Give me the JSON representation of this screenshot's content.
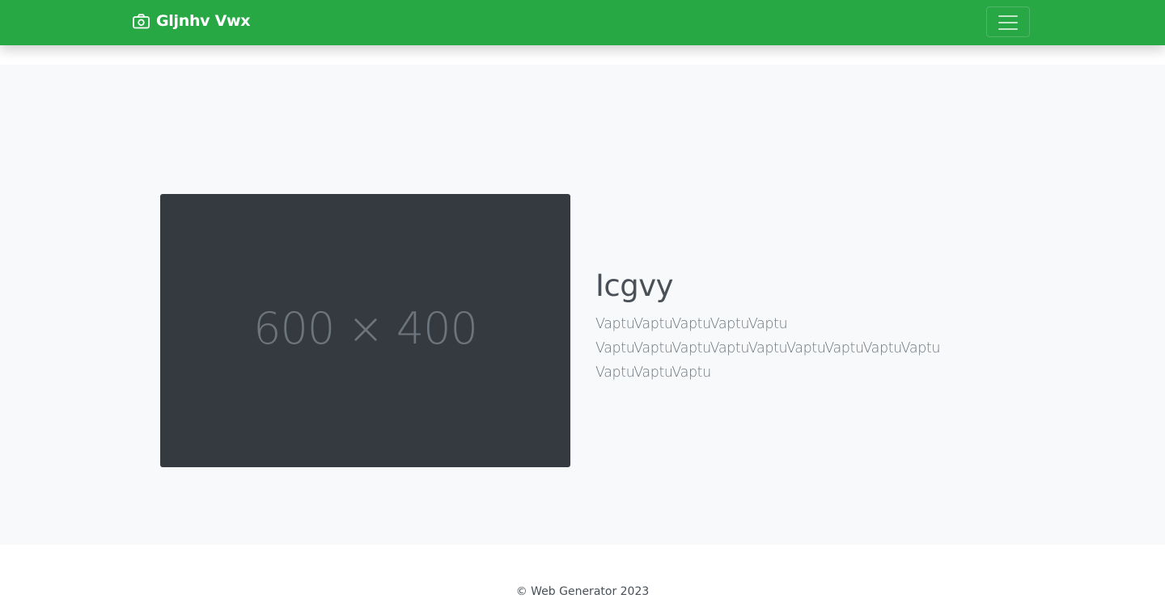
{
  "colors": {
    "navbar": "#28a745",
    "hero_background": "#f8f9fa",
    "placeholder_background": "#343a40",
    "placeholder_text": "#6c757d",
    "heading": "#495057",
    "body_text": "#6c757d"
  },
  "navbar": {
    "brand_icon": "camera-icon",
    "brand_text": "Gljnhv Vwx",
    "toggle_icon": "hamburger-menu-icon"
  },
  "hero": {
    "image_placeholder": "600 × 400",
    "title": "Icgvy",
    "text_lines": [
      "VaptuVaptuVaptuVaptuVaptu",
      "VaptuVaptuVaptuVaptuVaptuVaptuVaptuVaptuVaptu",
      "VaptuVaptuVaptu"
    ]
  },
  "footer": {
    "text": "© Web Generator 2023"
  }
}
